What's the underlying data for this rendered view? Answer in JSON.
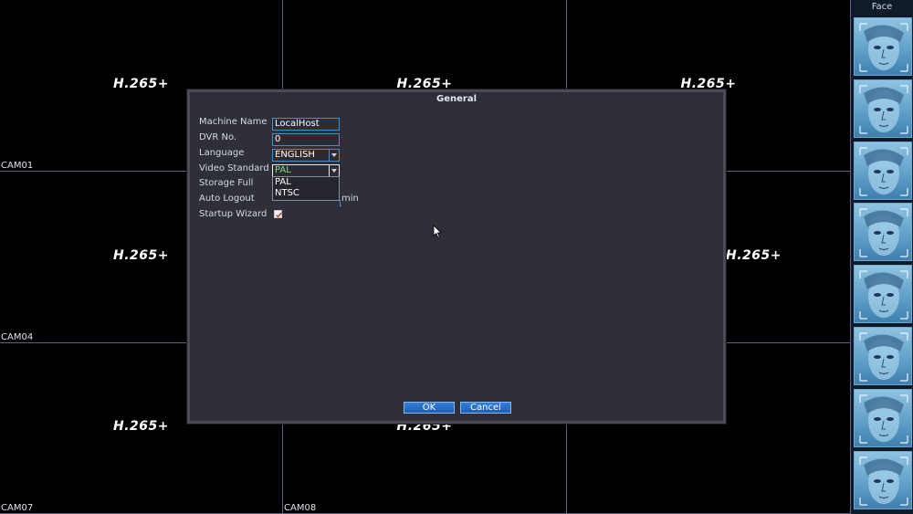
{
  "cameras": [
    {
      "label": "CAM01",
      "codec": "H.265+"
    },
    {
      "label": "",
      "codec": "H.265+"
    },
    {
      "label": "",
      "codec": "H.265+"
    },
    {
      "label": "CAM04",
      "codec": "H.265+"
    },
    {
      "label": "",
      "codec": ""
    },
    {
      "label": "",
      "codec": "H.265+"
    },
    {
      "label": "CAM07",
      "codec": "H.265+"
    },
    {
      "label": "CAM08",
      "codec": "H.265+"
    },
    {
      "label": "",
      "codec": ""
    }
  ],
  "face_panel": {
    "title": "Face",
    "thumb_count": 8
  },
  "dialog": {
    "title": "General",
    "fields": {
      "machine_name": {
        "label": "Machine Name",
        "value": "LocalHost"
      },
      "dvr_no": {
        "label": "DVR No.",
        "value": "0"
      },
      "language": {
        "label": "Language",
        "value": "ENGLISH"
      },
      "video_standard": {
        "label": "Video Standard",
        "value": "PAL",
        "options": [
          "PAL",
          "NTSC"
        ]
      },
      "storage_full": {
        "label": "Storage Full"
      },
      "auto_logout": {
        "label": "Auto Logout",
        "unit": "min"
      },
      "startup_wizard": {
        "label": "Startup Wizard",
        "checked": true
      }
    },
    "buttons": {
      "ok": "OK",
      "cancel": "Cancel"
    }
  },
  "colors": {
    "accent": "#3f8fd1",
    "selected_value": "#7de07d",
    "button": "#1f5fb8"
  }
}
